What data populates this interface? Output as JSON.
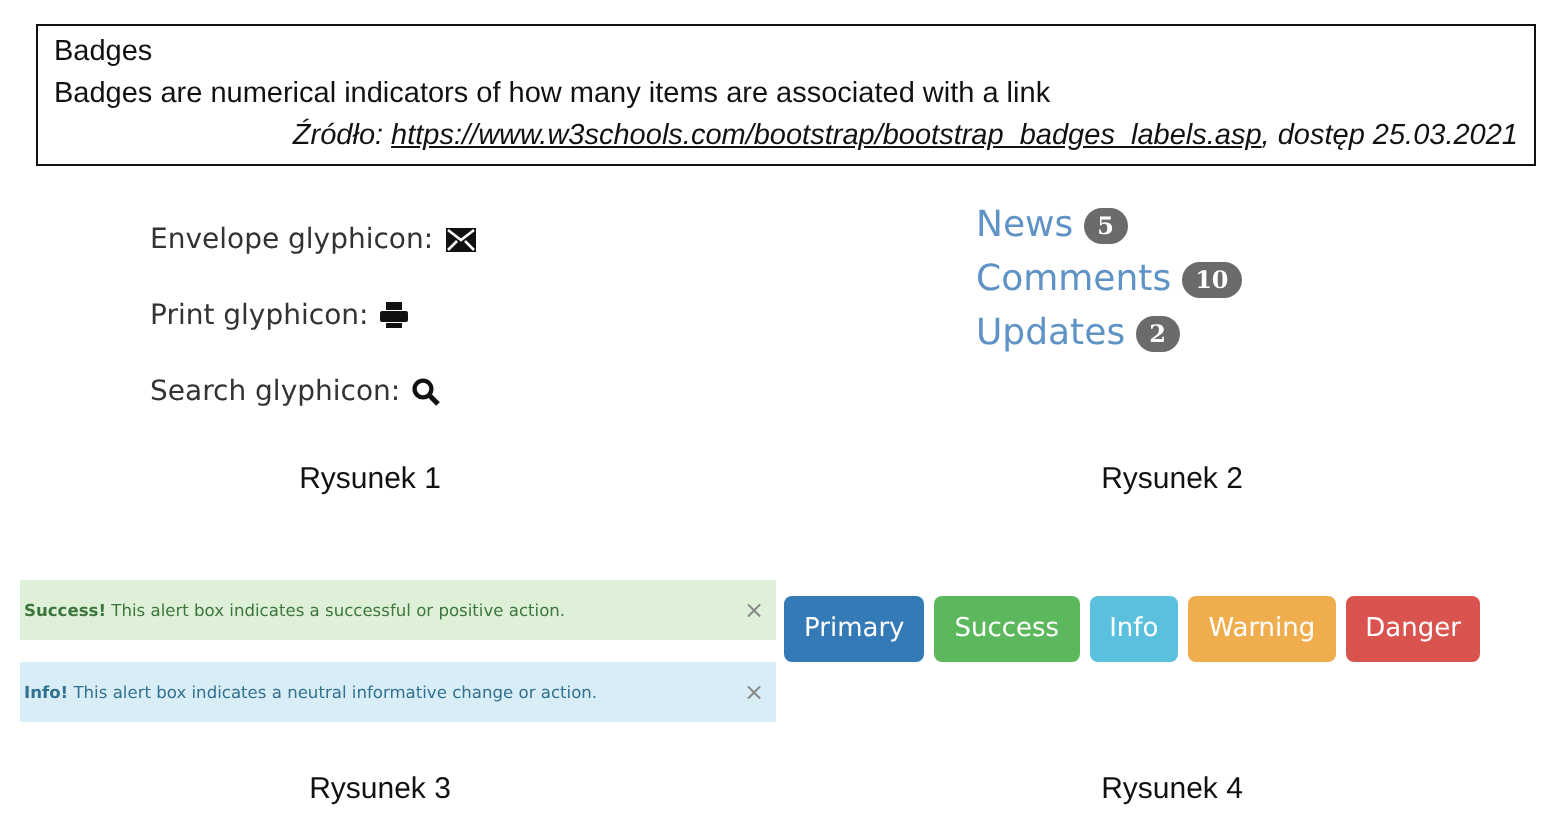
{
  "source_box": {
    "title": "Badges",
    "description": "Badges are numerical indicators of how many items are associated with a link",
    "citation": {
      "prefix": "Źródło:",
      "url": "https://www.w3schools.com/bootstrap/bootstrap_badges_labels.asp",
      "suffix": ", dostęp 25.03.2021"
    }
  },
  "figures": [
    {
      "kind": "glyphicons",
      "caption": "Rysunek 1",
      "items": [
        {
          "label": "Envelope glyphicon:",
          "kind": "envelope"
        },
        {
          "label": "Print glyphicon:",
          "kind": "print"
        },
        {
          "label": "Search glyphicon:",
          "kind": "search"
        }
      ]
    },
    {
      "kind": "badges",
      "caption": "Rysunek 2",
      "items": [
        {
          "label": "News",
          "badge": "5"
        },
        {
          "label": "Comments",
          "badge": "10"
        },
        {
          "label": "Updates",
          "badge": "2"
        }
      ]
    },
    {
      "kind": "alerts",
      "caption": "Rysunek 3",
      "items": [
        {
          "kind": "success",
          "title": "Success!",
          "text": "This alert box indicates a successful or positive action.",
          "close": "×"
        },
        {
          "kind": "info",
          "title": "Info!",
          "text": "This alert box indicates a neutral informative change or action.",
          "close": "×"
        }
      ]
    },
    {
      "kind": "buttons",
      "caption": "Rysunek 4",
      "items": [
        {
          "label": "Primary",
          "kind": "primary"
        },
        {
          "label": "Success",
          "kind": "success"
        },
        {
          "label": "Info",
          "kind": "info"
        },
        {
          "label": "Warning",
          "kind": "warning"
        },
        {
          "label": "Danger",
          "kind": "danger"
        }
      ]
    }
  ]
}
